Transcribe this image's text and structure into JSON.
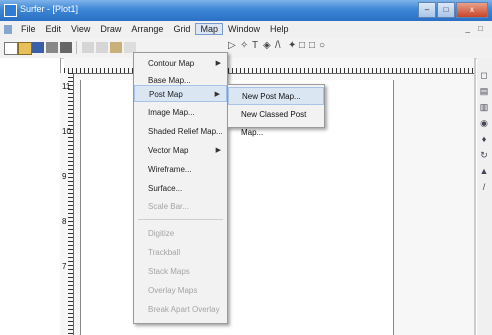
{
  "window": {
    "title": "Surfer - [Plot1]",
    "controls": [
      "–",
      "□",
      "x"
    ]
  },
  "menubar": {
    "items": [
      "File",
      "Edit",
      "View",
      "Draw",
      "Arrange",
      "Grid",
      "Map",
      "Window",
      "Help"
    ],
    "active": "Map",
    "mdi_controls": "_ □"
  },
  "map_menu": {
    "items": [
      {
        "label": "Contour Map",
        "submenu": true,
        "enabled": true
      },
      {
        "label": "Base Map...",
        "submenu": false,
        "enabled": true
      },
      {
        "label": "Post Map",
        "submenu": true,
        "enabled": true,
        "highlighted": true
      },
      {
        "label": "Image Map...",
        "submenu": false,
        "enabled": true
      },
      {
        "label": "Shaded Relief Map...",
        "submenu": false,
        "enabled": true
      },
      {
        "label": "Vector Map",
        "submenu": true,
        "enabled": true
      },
      {
        "label": "Wireframe...",
        "submenu": false,
        "enabled": true
      },
      {
        "label": "Surface...",
        "submenu": false,
        "enabled": true
      },
      {
        "label": "Scale Bar...",
        "submenu": false,
        "enabled": false
      },
      {
        "label": "Digitize",
        "submenu": false,
        "enabled": false
      },
      {
        "label": "Trackball",
        "submenu": false,
        "enabled": false
      },
      {
        "label": "Stack Maps",
        "submenu": false,
        "enabled": false
      },
      {
        "label": "Overlay Maps",
        "submenu": false,
        "enabled": false
      },
      {
        "label": "Break Apart Overlay",
        "submenu": false,
        "enabled": false
      }
    ]
  },
  "post_map_submenu": {
    "items": [
      "New Post Map...",
      "New Classed Post Map..."
    ]
  },
  "ruler": {
    "left_labels": [
      "11",
      "10",
      "9",
      "8",
      "7"
    ]
  },
  "colors": {
    "titlebar": "#3d86d6",
    "menu_highlight": "#dbe6f3"
  }
}
